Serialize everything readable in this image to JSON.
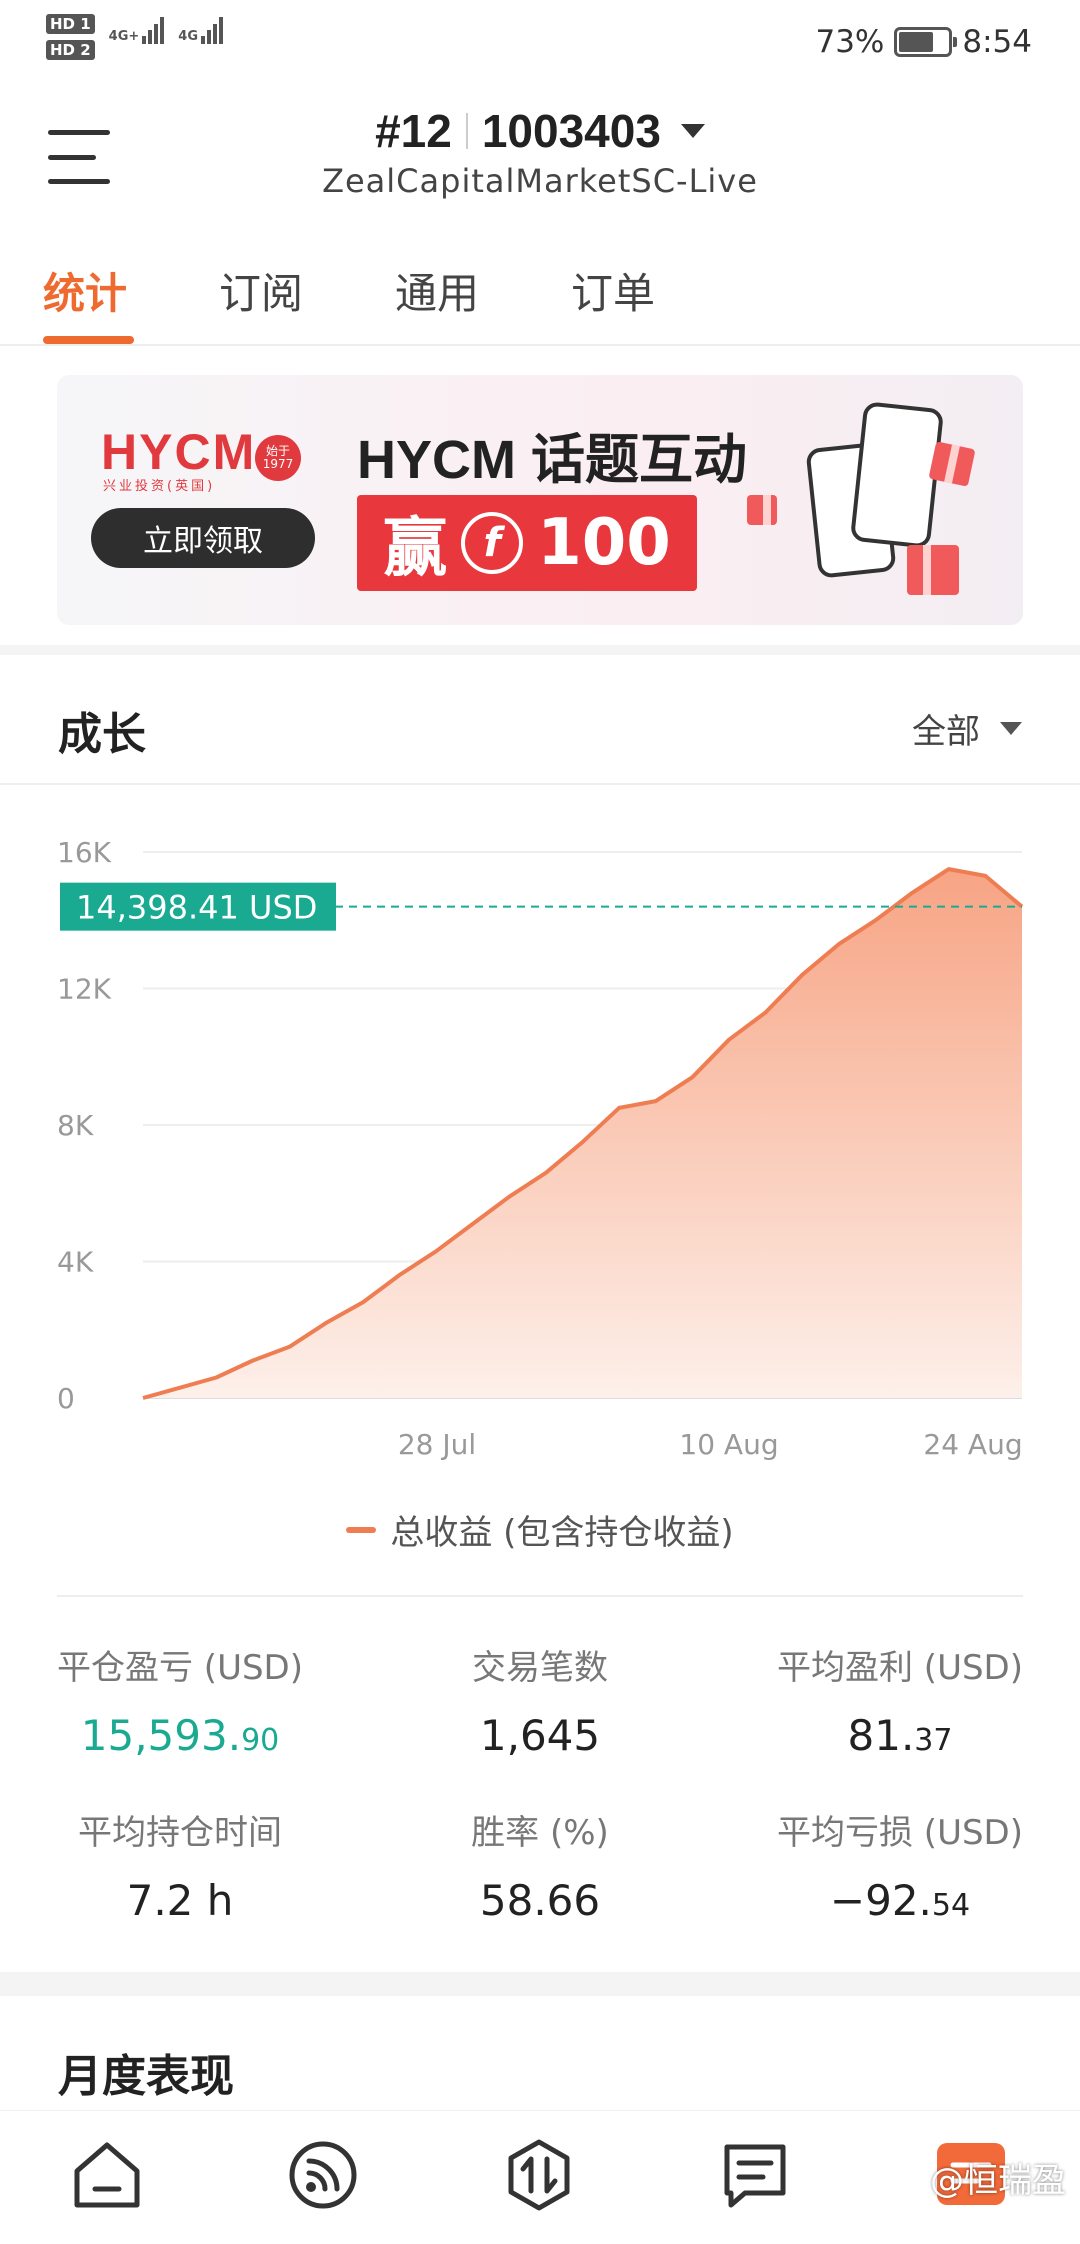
{
  "status_bar": {
    "sim1": "HD 1",
    "sim2": "HD 2",
    "net1": "4G+",
    "net2": "4G",
    "battery": "73%",
    "time": "8:54"
  },
  "header": {
    "account_index": "#12",
    "account_number": "1003403",
    "server": "ZealCapitalMarketSC-Live"
  },
  "tabs": [
    {
      "label": "统计",
      "active": true
    },
    {
      "label": "订阅",
      "active": false
    },
    {
      "label": "通用",
      "active": false
    },
    {
      "label": "订单",
      "active": false
    }
  ],
  "banner": {
    "logo": "HYCM",
    "logo_sub": "兴业投资(英国)",
    "logo_seal": "始于1977",
    "cta": "立即领取",
    "title": "HYCM 话题互动",
    "prize_prefix": "赢",
    "prize_coin": "f",
    "prize_amount": "100"
  },
  "growth": {
    "title": "成长",
    "range": "全部"
  },
  "chart_data": {
    "type": "area",
    "title": "",
    "xlabel": "",
    "ylabel": "",
    "ylim": [
      0,
      16000
    ],
    "y_ticks": [
      "0",
      "4K",
      "8K",
      "12K",
      "16K"
    ],
    "x_ticks": [
      "28 Jul",
      "10 Aug",
      "24 Aug"
    ],
    "current_label": "14,398.41 USD",
    "current_value": 14398.41,
    "series": [
      {
        "name": "总收益 (包含持仓收益)",
        "values": [
          0,
          300,
          600,
          1100,
          1500,
          2200,
          2800,
          3600,
          4300,
          5100,
          5900,
          6600,
          7500,
          8500,
          8700,
          9400,
          10500,
          11300,
          12400,
          13300,
          14000,
          14800,
          15500,
          15300,
          14398.41
        ]
      }
    ],
    "legend": "bottom",
    "colors": {
      "line": "#ef7d52",
      "fill_top": "#f7a484",
      "fill_bottom": "#fdf0ea",
      "marker": "#1aaa92",
      "grid": "#eeeeee"
    }
  },
  "stats": [
    {
      "label": "平仓盈亏 (USD)",
      "int": "15,593.",
      "dec": "90",
      "green": true
    },
    {
      "label": "交易笔数",
      "int": "1,645",
      "dec": "",
      "green": false
    },
    {
      "label": "平均盈利 (USD)",
      "int": "81.",
      "dec": "37",
      "green": false
    },
    {
      "label": "平均持仓时间",
      "int": "7.2 h",
      "dec": "",
      "green": false
    },
    {
      "label": "胜率 (%)",
      "int": "58.66",
      "dec": "",
      "green": false
    },
    {
      "label": "平均亏损 (USD)",
      "int": "−92.",
      "dec": "54",
      "green": false
    }
  ],
  "monthly": {
    "title": "月度表现"
  },
  "bottom_nav": [
    {
      "icon": "home-icon"
    },
    {
      "icon": "signal-feed-icon"
    },
    {
      "icon": "trade-icon"
    },
    {
      "icon": "messages-icon"
    },
    {
      "icon": "profile-icon"
    }
  ],
  "watermark": "@恒瑞盈"
}
